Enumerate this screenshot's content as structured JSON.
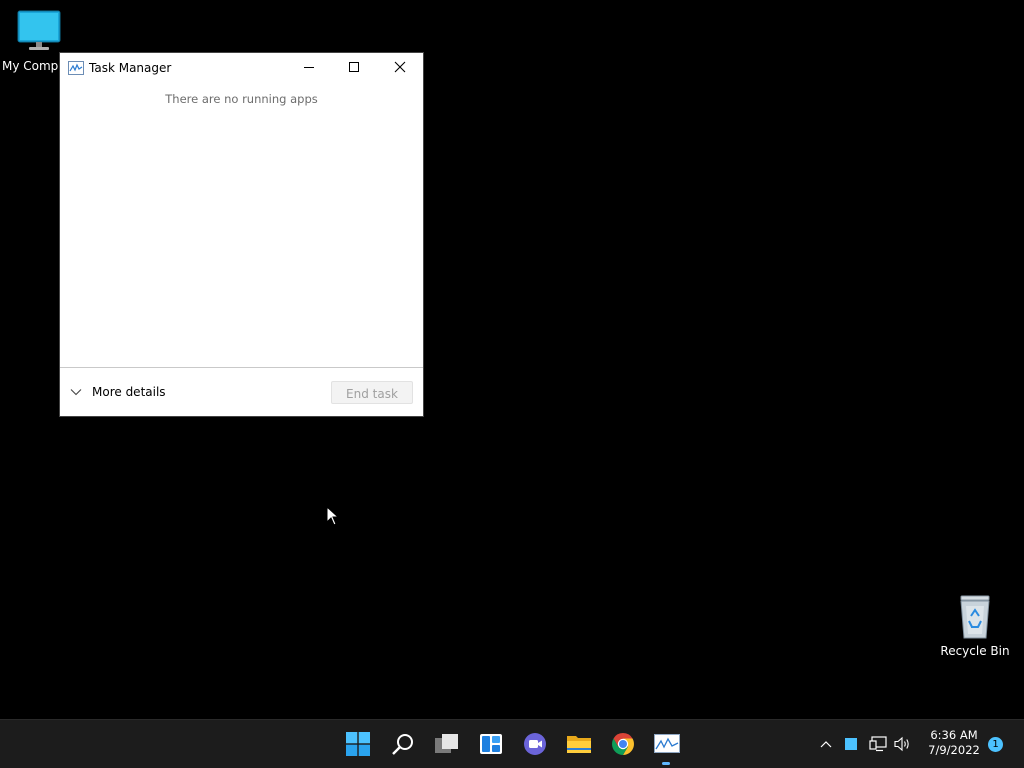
{
  "desktop": {
    "my_computer_label": "My Computer",
    "recycle_bin_label": "Recycle Bin"
  },
  "task_manager": {
    "title": "Task Manager",
    "empty_message": "There are no running apps",
    "more_details_label": "More details",
    "end_task_label": "End task",
    "end_task_enabled": false
  },
  "taskbar": {
    "apps": [
      "start-icon",
      "search-icon",
      "task-view-icon",
      "widgets-icon",
      "chat-icon",
      "file-explorer-icon",
      "chrome-icon",
      "task-manager-icon"
    ],
    "active_app": "task-manager-icon",
    "clock_time": "6:36 AM",
    "clock_date": "7/9/2022",
    "notification_count": "1"
  },
  "colors": {
    "accent": "#60b8ff",
    "taskbar_bg": "#1c1c1c",
    "desktop_bg": "#000000"
  }
}
